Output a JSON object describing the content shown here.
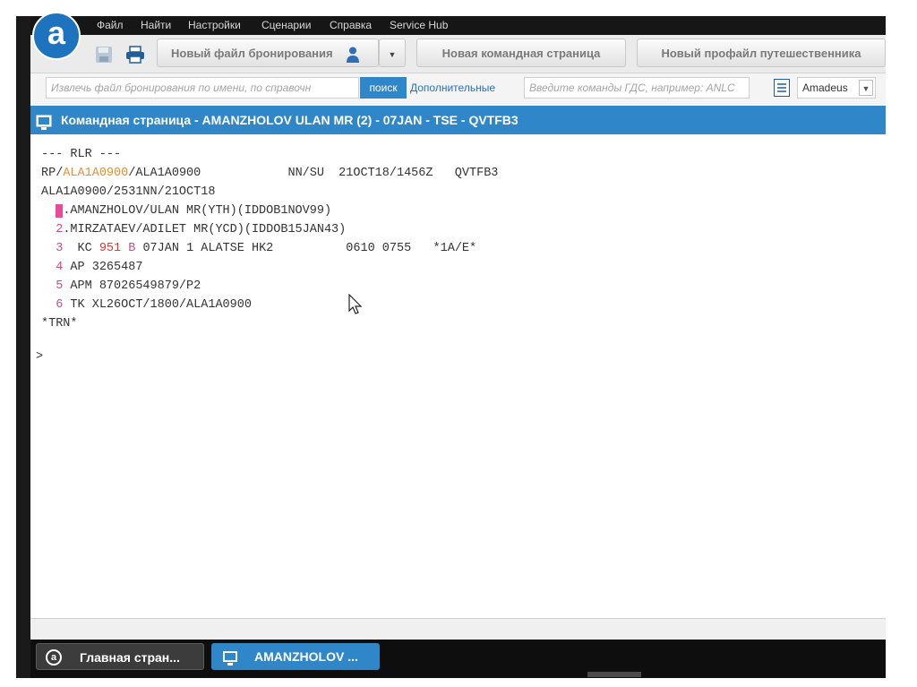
{
  "menu": [
    "Файл",
    "Найти",
    "Настройки",
    "Сценарии",
    "Справка",
    "Service Hub"
  ],
  "logo_letter": "a",
  "toolbar": {
    "new_booking": "Новый файл бронирования",
    "new_command": "Новая командная страница",
    "new_profile": "Новый профайл путешественника"
  },
  "search": {
    "placeholder": "Извлечь файл бронирования по имени, по справочн",
    "button": "поиск",
    "advanced": "Дополнительные",
    "command_placeholder": "Введите команды ГДС, например: ANLC",
    "system": "Amadeus"
  },
  "title": "Командная страница - AMANZHOLOV ULAN MR (2) - 07JAN - TSE - QVTFB3",
  "pnr": {
    "l0": "--- RLR ---",
    "l1a": "RP/",
    "l1b": "ALA1A0900",
    "l1c": "/ALA1A0900            NN/SU  21OCT18/1456Z   QVTFB3",
    "l2": "ALA1A0900/2531NN/21OCT18",
    "n1": "1",
    "l3": ".AMANZHOLOV/ULAN MR(YTH)(IDDOB1NOV99)",
    "n2": "2",
    "l4": ".MIRZATAEV/ADILET MR(YCD)(IDDOB15JAN43)",
    "n3": "3",
    "l5a": "  KC ",
    "l5b": "951",
    "l5c": " ",
    "l5d": "B",
    "l5e": " 07JAN 1 ALATSE HK2          0610 0755   *1A/E*",
    "n4": "4",
    "l6": " AP 3265487",
    "n5": "5",
    "l7": " APM 87026549879/P2",
    "n6": "6",
    "l8": " TK XL26OCT/1800/ALA1A0900",
    "l9": "*TRN*",
    "prompt": ">"
  },
  "taskbar": {
    "home": "Главная стран...",
    "session": "AMANZHOLOV ..."
  },
  "colors": {
    "accent": "#2f86c8",
    "logo": "#1e73be",
    "pnr_number": "#c84b8a",
    "office_id": "#e58f2a",
    "flight_number": "#d23c2c"
  }
}
